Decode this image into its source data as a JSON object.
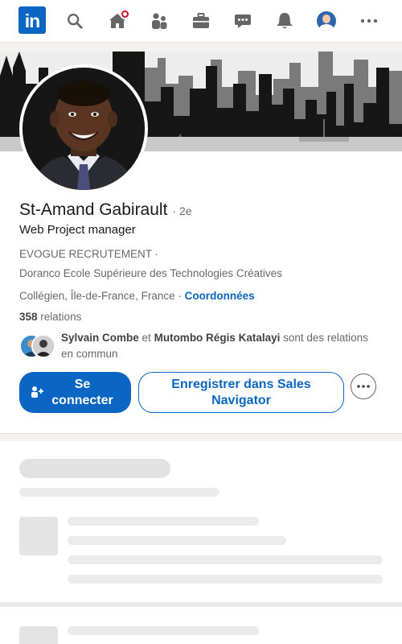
{
  "nav": {
    "logo_text": "in",
    "icons": [
      "search-icon",
      "home-icon",
      "network-icon",
      "jobs-briefcase-icon",
      "messaging-icon",
      "notifications-bell-icon",
      "me-avatar",
      "more-icon"
    ],
    "home_notification": true
  },
  "profile": {
    "name": "St-Amand Gabirault",
    "degree": "· 2e",
    "headline": "Web Project manager",
    "company": "EVOGUE RECRUTEMENT ·",
    "education": "Doranco Ecole Supérieure des Technologies Créatives",
    "location": "Collégien, Île-de-France, France ·",
    "contact_link": "Coordonnées",
    "relations_count": "358",
    "relations_label": "relations"
  },
  "mutual": {
    "person1": "Sylvain Combe",
    "connector": "et",
    "person2": "Mutombo Régis Katalayi",
    "suffix": "sont des relations en commun"
  },
  "actions": {
    "connect_label": "Se connecter",
    "sales_nav_label": "Enregistrer dans Sales Navigator",
    "more_icon": "ellipsis-icon"
  },
  "colors": {
    "brand": "#0a66c2",
    "badge": "#cb112d",
    "page_bg": "#f3f2ef",
    "skeleton": "#e6e6e6"
  }
}
